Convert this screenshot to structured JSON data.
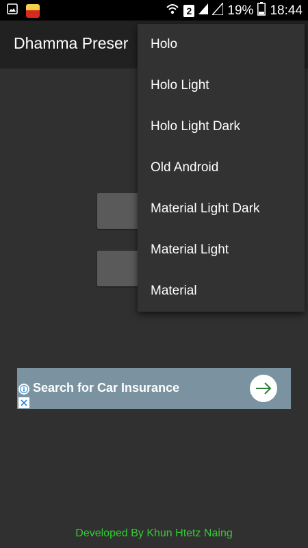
{
  "status_bar": {
    "icons": [
      "image-icon",
      "app-notification-icon",
      "wifi-icon",
      "sim2-icon",
      "signal-icon",
      "signal-icon-2",
      "battery-icon"
    ],
    "sim_label": "2",
    "battery_percent": "19%",
    "time": "18:44"
  },
  "app_bar": {
    "title": "Dhamma Preser"
  },
  "menu": {
    "items": [
      {
        "label": "Holo"
      },
      {
        "label": "Holo Light"
      },
      {
        "label": "Holo Light Dark"
      },
      {
        "label": "Old Android"
      },
      {
        "label": "Material Light Dark"
      },
      {
        "label": "Material Light"
      },
      {
        "label": "Material"
      }
    ]
  },
  "ad": {
    "text": "Search for Car Insurance",
    "icons": [
      "info-icon",
      "close-icon",
      "arrow-right-icon"
    ],
    "accent_color": "#2e7d32"
  },
  "footer": {
    "text": "Developed By Khun Htetz Naing",
    "color": "#33cc33"
  }
}
